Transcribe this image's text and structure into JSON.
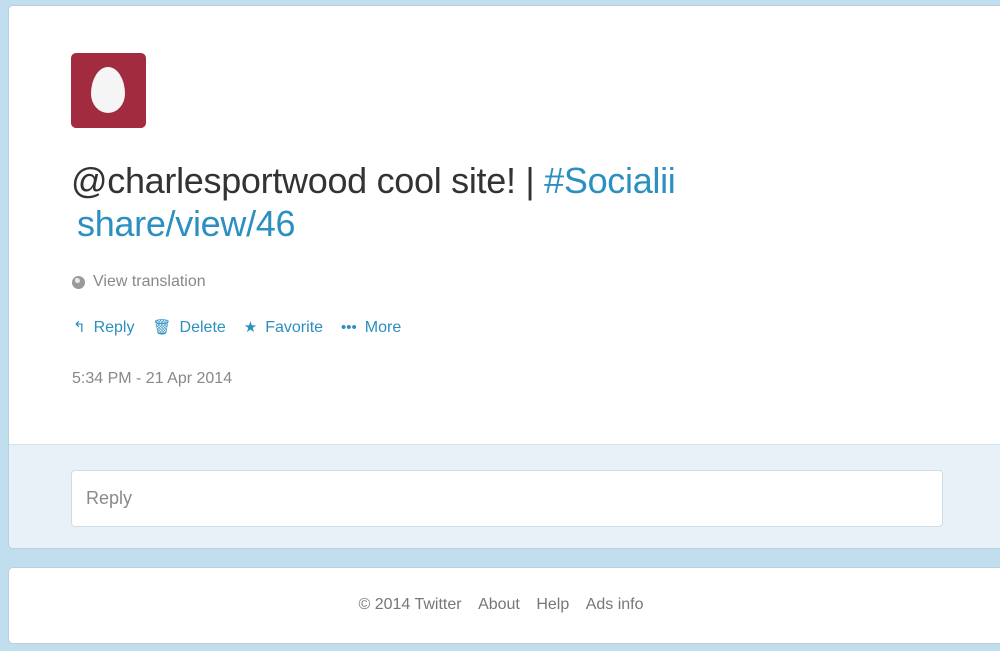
{
  "tweet": {
    "mention": "@charlesportwood",
    "body_text": " cool site! | ",
    "hashtag": "#Socialii",
    "link": "share/view/46",
    "translate_label": "View translation",
    "timestamp": "5:34 PM - 21 Apr 2014",
    "avatar_color": "#a32b3f"
  },
  "actions": {
    "reply": "Reply",
    "delete": "Delete",
    "favorite": "Favorite",
    "more": "More"
  },
  "reply_box": {
    "placeholder": "Reply"
  },
  "footer": {
    "copyright": "© 2014 Twitter",
    "about": "About",
    "help": "Help",
    "ads_info": "Ads info"
  },
  "colors": {
    "link": "#2b8fc0",
    "background": "#c0deed"
  }
}
